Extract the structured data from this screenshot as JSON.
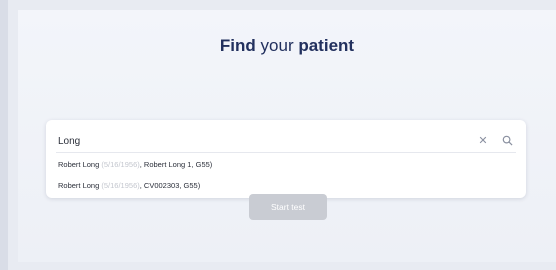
{
  "title": {
    "prefix": "Find",
    "middle": " your ",
    "suffix": "patient"
  },
  "search": {
    "value": "Long",
    "placeholder": "",
    "clear_icon": "✕",
    "search_icon": "🔍"
  },
  "results": [
    {
      "name": "Robert Long",
      "dob": "(5/16/1956)",
      "details": ", Robert Long 1, G55)"
    },
    {
      "name": "Robert Long",
      "dob": "(5/16/1956)",
      "details": ", CV002303, G55)"
    }
  ],
  "start_button": {
    "label": "Start test"
  }
}
